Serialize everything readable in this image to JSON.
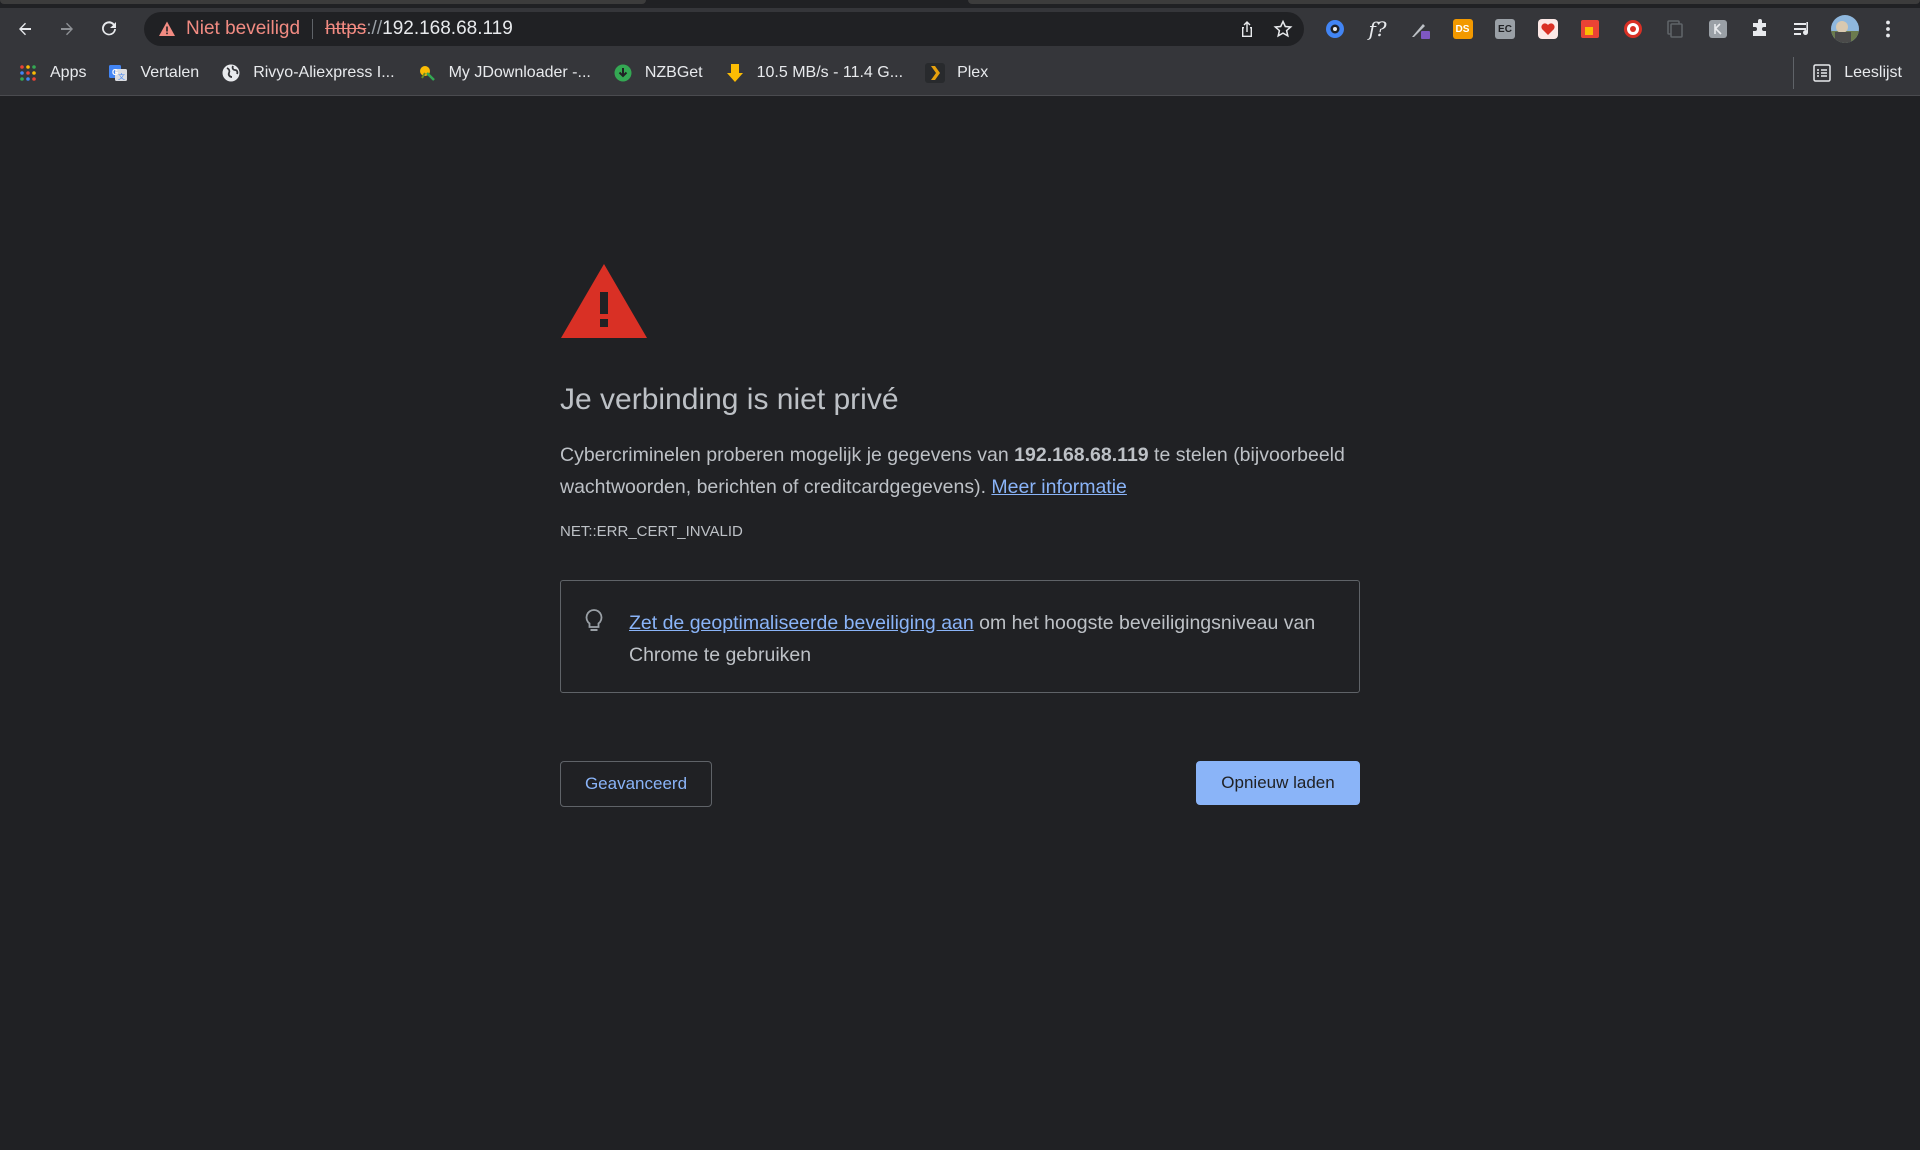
{
  "browser": {
    "security_chip": "Niet beveiligd",
    "url_scheme": "https",
    "url_separator": "://",
    "url_host": "192.168.68.119",
    "reading_list": "Leeslijst"
  },
  "bookmarks": [
    {
      "label": "Apps",
      "icon": "apps-grid-icon"
    },
    {
      "label": "Vertalen",
      "icon": "google-translate-icon"
    },
    {
      "label": "Rivyo-Aliexpress I...",
      "icon": "globe-icon"
    },
    {
      "label": "My JDownloader -...",
      "icon": "jdownloader-icon"
    },
    {
      "label": "NZBGet",
      "icon": "nzbget-icon"
    },
    {
      "label": "10.5 MB/s - 11.4 G...",
      "icon": "download-arrow-icon"
    },
    {
      "label": "Plex",
      "icon": "plex-icon"
    }
  ],
  "extensions": [
    {
      "name": "ext-blue-circle",
      "color": "#4285f4"
    },
    {
      "name": "ext-font-question",
      "text": "f?"
    },
    {
      "name": "ext-eyedropper",
      "color": "#9aa0a6"
    },
    {
      "name": "ext-ds",
      "text": "DS",
      "color": "#f29900"
    },
    {
      "name": "ext-ec",
      "text": "EC",
      "color": "#9aa0a6"
    },
    {
      "name": "ext-heart",
      "color": "#d93025"
    },
    {
      "name": "ext-red-square",
      "color": "#ea4335"
    },
    {
      "name": "ext-target",
      "color": "#d93025"
    },
    {
      "name": "ext-copy",
      "color": "#5f6368"
    },
    {
      "name": "ext-grey-k",
      "color": "#9aa0a6"
    },
    {
      "name": "extensions-puzzle",
      "color": "#e8eaed"
    },
    {
      "name": "media-controls",
      "color": "#e8eaed"
    }
  ],
  "interstitial": {
    "heading": "Je verbinding is niet privé",
    "explanation_pre": "Cybercriminelen proberen mogelijk je gegevens van ",
    "explanation_host": "192.168.68.119",
    "explanation_post": " te stelen (bijvoorbeeld wachtwoorden, berichten of creditcardgegevens). ",
    "learn_more": "Meer informatie",
    "error_code": "NET::ERR_CERT_INVALID",
    "safe_browsing_link": "Zet de geoptimaliseerde beveiliging aan",
    "safe_browsing_text": " om het hoogste beveiligingsniveau van Chrome te gebruiken",
    "advanced_button": "Geavanceerd",
    "reload_button": "Opnieuw laden"
  },
  "colors": {
    "background": "#202124",
    "warning_red": "#d93025",
    "link_blue": "#8ab4f8",
    "text": "#bdc1c6"
  }
}
